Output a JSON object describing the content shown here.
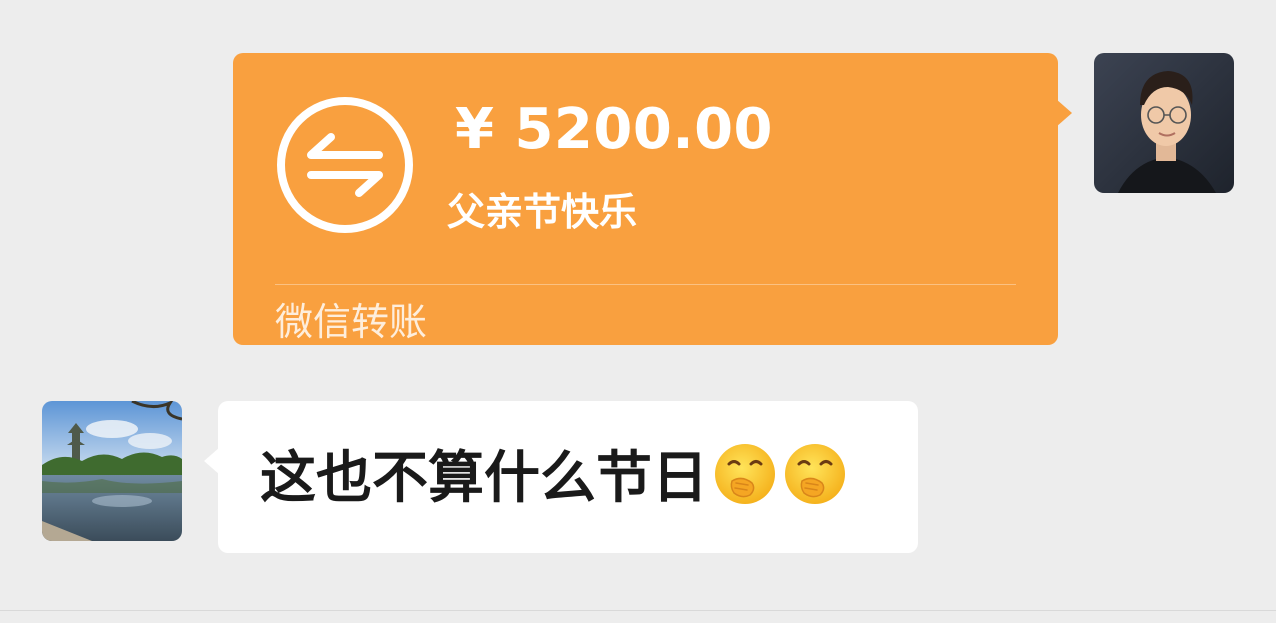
{
  "messages": {
    "transfer": {
      "amount": "¥ 5200.00",
      "note": "父亲节快乐",
      "footer": "微信转账",
      "icon": "transfer-arrows-icon",
      "accent_color": "#f9a03f"
    },
    "received": {
      "text": "这也不算什么节日",
      "emoji": [
        "face-with-hand-over-mouth",
        "face-with-hand-over-mouth"
      ]
    }
  },
  "avatars": {
    "self": "man-with-glasses-photo",
    "other": "park-lake-pagoda-photo"
  },
  "colors": {
    "background": "#ededed",
    "bubble_received": "#ffffff",
    "text_primary": "#1a1a1a"
  }
}
